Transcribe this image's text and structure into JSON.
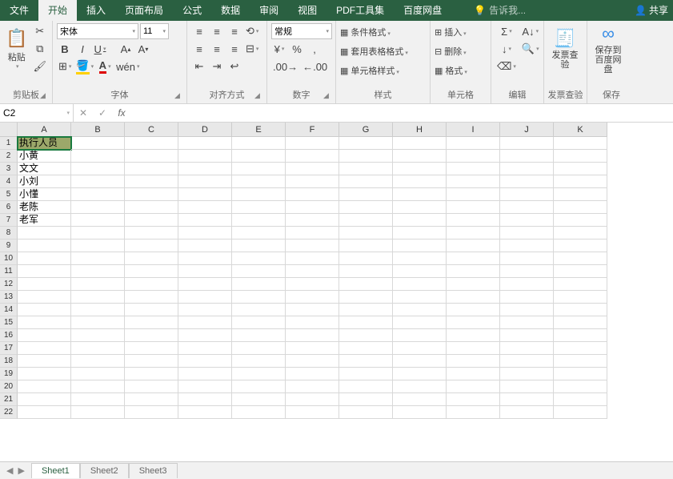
{
  "tabs": {
    "file": "文件",
    "home": "开始",
    "insert": "插入",
    "layout": "页面布局",
    "formulas": "公式",
    "data": "数据",
    "review": "审阅",
    "view": "视图",
    "pdf": "PDF工具集",
    "baidu": "百度网盘",
    "tell_me": "告诉我...",
    "share": "共享"
  },
  "groups": {
    "clipboard": "剪贴板",
    "font": "字体",
    "align": "对齐方式",
    "number": "数字",
    "styles": "样式",
    "cells": "单元格",
    "editing": "编辑",
    "invoice": "发票查验",
    "save": "保存"
  },
  "paste": {
    "label": "粘贴"
  },
  "font": {
    "name": "宋体",
    "size": "11"
  },
  "number": {
    "format": "常规"
  },
  "styles": {
    "cond": "条件格式",
    "table": "套用表格格式",
    "cell": "单元格样式"
  },
  "cells": {
    "insert": "插入",
    "delete": "删除",
    "format": "格式"
  },
  "invoice": {
    "check": "发票查验"
  },
  "baidu_save": {
    "label": "保存到百度网盘"
  },
  "namebox": "C2",
  "columns": [
    "A",
    "B",
    "C",
    "D",
    "E",
    "F",
    "G",
    "H",
    "I",
    "J",
    "K"
  ],
  "rows": [
    "1",
    "2",
    "3",
    "4",
    "5",
    "6",
    "7",
    "8",
    "9",
    "10",
    "11",
    "12",
    "13",
    "14",
    "15",
    "16",
    "17",
    "18",
    "19",
    "20",
    "21",
    "22"
  ],
  "data": {
    "A1": "执行人员",
    "A2": "小黄",
    "A3": "文文",
    "A4": "小刘",
    "A5": "小懂",
    "A6": "老陈",
    "A7": "老军"
  },
  "sheets": [
    "Sheet1",
    "Sheet2",
    "Sheet3"
  ]
}
